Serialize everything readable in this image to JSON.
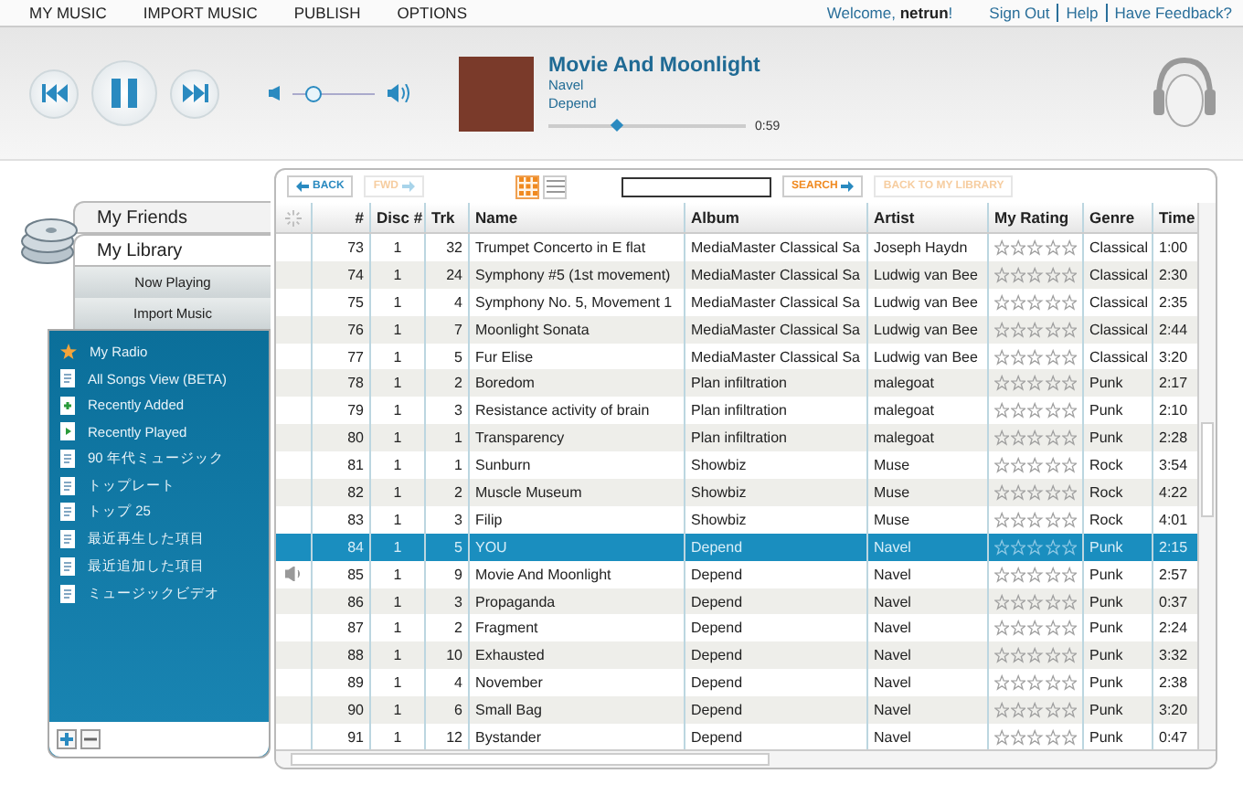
{
  "menu": [
    {
      "label": "MY MUSIC"
    },
    {
      "label": "IMPORT MUSIC"
    },
    {
      "label": "PUBLISH"
    },
    {
      "label": "OPTIONS"
    }
  ],
  "welcome": "Welcome, **netrun**!",
  "links": [
    "Sign Out",
    "Help",
    "Have Feedback?"
  ],
  "player": {
    "title": "Movie And Moonlight",
    "artist": "Navel",
    "album": "Depend",
    "elapsed": "0:59",
    "progress": {
      "level": 0.35
    },
    "volume": {
      "level": 0.25
    }
  },
  "sidebar": {
    "tabs": [
      {
        "label": "My Friends",
        "selected": false
      },
      {
        "label": "My Library",
        "selected": true
      }
    ],
    "subtabs": [
      {
        "label": "Now Playing"
      },
      {
        "label": "Import Music"
      }
    ],
    "items": [
      {
        "label": "My Radio",
        "kind": "radio"
      },
      {
        "label": "All Songs View (BETA)",
        "kind": "playlist"
      },
      {
        "label": "Recently Added",
        "kind": "added"
      },
      {
        "label": "Recently Played",
        "kind": "played"
      },
      {
        "label": "90 年代ミュージック",
        "kind": "playlist"
      },
      {
        "label": "トップレート",
        "kind": "playlist"
      },
      {
        "label": "トップ 25",
        "kind": "playlist"
      },
      {
        "label": "最近再生した項目",
        "kind": "playlist"
      },
      {
        "label": "最近追加した項目",
        "kind": "playlist"
      },
      {
        "label": "ミュージックビデオ",
        "kind": "playlist"
      }
    ]
  },
  "toolbar": {
    "back": {
      "label": "BACK",
      "disabled": false
    },
    "fwd": {
      "label": "FWD",
      "disabled": true
    },
    "views": [
      {
        "kind": "grid",
        "selected": true
      },
      {
        "kind": "list",
        "selected": false
      }
    ],
    "search_button": "SEARCH",
    "library_button": {
      "label": "BACK TO MY LIBRARY",
      "disabled": true
    }
  },
  "table": {
    "columns": [
      "#",
      "Disc #",
      "Trk",
      "Name",
      "Album",
      "Artist",
      "My Rating",
      "Genre",
      "Time"
    ],
    "rows": [
      {
        "n": "73",
        "disc": "1",
        "trk": "32",
        "name": "Trumpet Concerto in E flat",
        "album": "MediaMaster Classical Sa",
        "artist": "Joseph Haydn",
        "genre": "Classical",
        "time": "1:00",
        "selected": false,
        "playing": false
      },
      {
        "n": "74",
        "disc": "1",
        "trk": "24",
        "name": "Symphony #5 (1st movement)",
        "album": "MediaMaster Classical Sa",
        "artist": "Ludwig van Bee",
        "genre": "Classical",
        "time": "2:30",
        "selected": false,
        "playing": false
      },
      {
        "n": "75",
        "disc": "1",
        "trk": "4",
        "name": "Symphony No. 5, Movement 1",
        "album": "MediaMaster Classical Sa",
        "artist": "Ludwig van Bee",
        "genre": "Classical",
        "time": "2:35",
        "selected": false,
        "playing": false
      },
      {
        "n": "76",
        "disc": "1",
        "trk": "7",
        "name": "Moonlight Sonata",
        "album": "MediaMaster Classical Sa",
        "artist": "Ludwig van Bee",
        "genre": "Classical",
        "time": "2:44",
        "selected": false,
        "playing": false
      },
      {
        "n": "77",
        "disc": "1",
        "trk": "5",
        "name": "Fur Elise",
        "album": "MediaMaster Classical Sa",
        "artist": "Ludwig van Bee",
        "genre": "Classical",
        "time": "3:20",
        "selected": false,
        "playing": false
      },
      {
        "n": "78",
        "disc": "1",
        "trk": "2",
        "name": "Boredom",
        "album": "Plan infiltration",
        "artist": "malegoat",
        "genre": "Punk",
        "time": "2:17",
        "selected": false,
        "playing": false
      },
      {
        "n": "79",
        "disc": "1",
        "trk": "3",
        "name": "Resistance activity of brain",
        "album": "Plan infiltration",
        "artist": "malegoat",
        "genre": "Punk",
        "time": "2:10",
        "selected": false,
        "playing": false
      },
      {
        "n": "80",
        "disc": "1",
        "trk": "1",
        "name": "Transparency",
        "album": "Plan infiltration",
        "artist": "malegoat",
        "genre": "Punk",
        "time": "2:28",
        "selected": false,
        "playing": false
      },
      {
        "n": "81",
        "disc": "1",
        "trk": "1",
        "name": "Sunburn",
        "album": "Showbiz",
        "artist": "Muse",
        "genre": "Rock",
        "time": "3:54",
        "selected": false,
        "playing": false
      },
      {
        "n": "82",
        "disc": "1",
        "trk": "2",
        "name": "Muscle Museum",
        "album": "Showbiz",
        "artist": "Muse",
        "genre": "Rock",
        "time": "4:22",
        "selected": false,
        "playing": false
      },
      {
        "n": "83",
        "disc": "1",
        "trk": "3",
        "name": "Filip",
        "album": "Showbiz",
        "artist": "Muse",
        "genre": "Rock",
        "time": "4:01",
        "selected": false,
        "playing": false
      },
      {
        "n": "84",
        "disc": "1",
        "trk": "5",
        "name": "YOU",
        "album": "Depend",
        "artist": "Navel",
        "genre": "Punk",
        "time": "2:15",
        "selected": true,
        "playing": false
      },
      {
        "n": "85",
        "disc": "1",
        "trk": "9",
        "name": "Movie And Moonlight",
        "album": "Depend",
        "artist": "Navel",
        "genre": "Punk",
        "time": "2:57",
        "selected": false,
        "playing": true
      },
      {
        "n": "86",
        "disc": "1",
        "trk": "3",
        "name": "Propaganda",
        "album": "Depend",
        "artist": "Navel",
        "genre": "Punk",
        "time": "0:37",
        "selected": false,
        "playing": false
      },
      {
        "n": "87",
        "disc": "1",
        "trk": "2",
        "name": "Fragment",
        "album": "Depend",
        "artist": "Navel",
        "genre": "Punk",
        "time": "2:24",
        "selected": false,
        "playing": false
      },
      {
        "n": "88",
        "disc": "1",
        "trk": "10",
        "name": "Exhausted",
        "album": "Depend",
        "artist": "Navel",
        "genre": "Punk",
        "time": "3:32",
        "selected": false,
        "playing": false
      },
      {
        "n": "89",
        "disc": "1",
        "trk": "4",
        "name": "November",
        "album": "Depend",
        "artist": "Navel",
        "genre": "Punk",
        "time": "2:38",
        "selected": false,
        "playing": false
      },
      {
        "n": "90",
        "disc": "1",
        "trk": "6",
        "name": "Small Bag",
        "album": "Depend",
        "artist": "Navel",
        "genre": "Punk",
        "time": "3:20",
        "selected": false,
        "playing": false
      },
      {
        "n": "91",
        "disc": "1",
        "trk": "12",
        "name": "Bystander",
        "album": "Depend",
        "artist": "Navel",
        "genre": "Punk",
        "time": "0:47",
        "selected": false,
        "playing": false
      }
    ]
  }
}
